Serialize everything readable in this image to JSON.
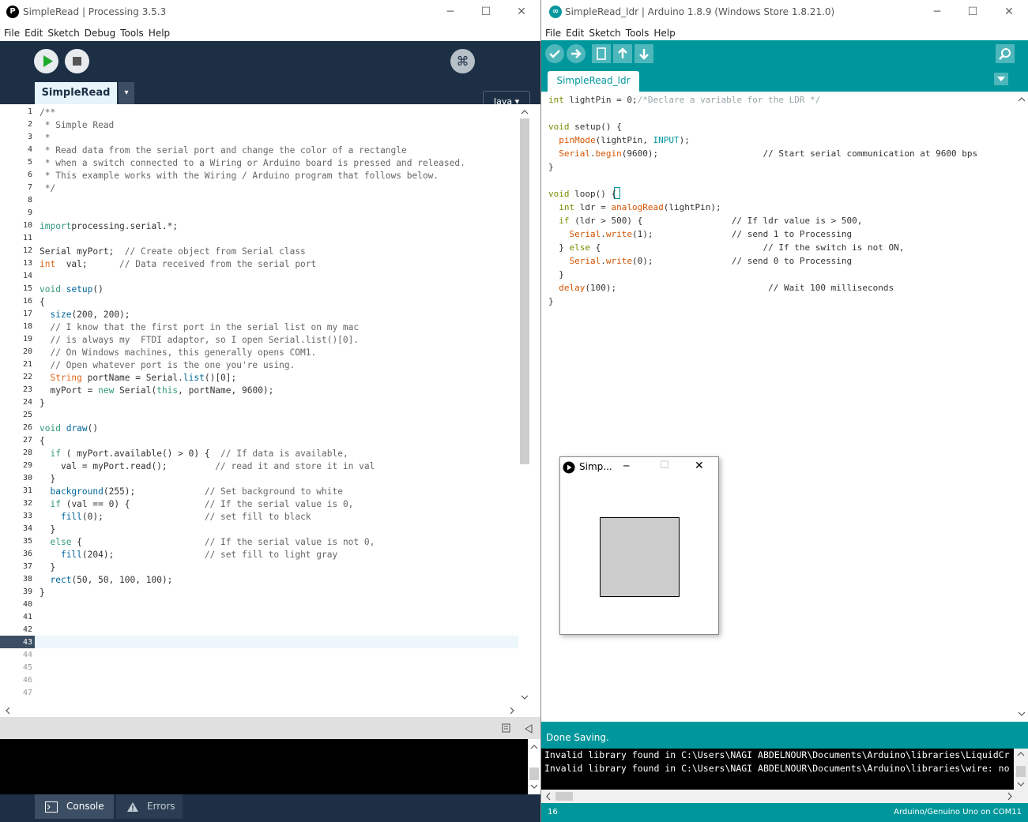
{
  "processing": {
    "title": "SimpleRead | Processing 3.5.3",
    "app_icon": "P",
    "menu": [
      "File",
      "Edit",
      "Sketch",
      "Debug",
      "Tools",
      "Help"
    ],
    "mode": "Java ▾",
    "tab": "SimpleRead",
    "tab_menu": "▾",
    "lines": [
      [
        [
          "cm",
          "/**"
        ]
      ],
      [
        [
          "cm",
          " * Simple Read"
        ]
      ],
      [
        [
          "cm",
          " *"
        ]
      ],
      [
        [
          "cm",
          " * Read data from the serial port and change the color of a rectangle"
        ]
      ],
      [
        [
          "cm",
          " * when a switch connected to a Wiring or Arduino board is pressed and released."
        ]
      ],
      [
        [
          "cm",
          " * This example works with the Wiring / Arduino program that follows below."
        ]
      ],
      [
        [
          "cm",
          " */"
        ]
      ],
      [],
      [],
      [
        [
          "kw",
          "import"
        ],
        [
          "",
          "processing.serial.*;"
        ]
      ],
      [],
      [
        [
          "",
          "Serial myPort;  "
        ],
        [
          "cm",
          "// Create object from Serial class"
        ]
      ],
      [
        [
          "ty",
          "int"
        ],
        [
          "",
          "  val;      "
        ],
        [
          "cm",
          "// Data received from the serial port"
        ]
      ],
      [],
      [
        [
          "kw",
          "void"
        ],
        [
          "",
          " "
        ],
        [
          "fn",
          "setup"
        ],
        [
          "",
          "()"
        ]
      ],
      [
        [
          "",
          "{"
        ]
      ],
      [
        [
          "",
          "  "
        ],
        [
          "fn",
          "size"
        ],
        [
          "",
          "(200, 200);"
        ]
      ],
      [
        [
          "cm",
          "  // I know that the first port in the serial list on my mac"
        ]
      ],
      [
        [
          "cm",
          "  // is always my  FTDI adaptor, so I open Serial.list()[0]."
        ]
      ],
      [
        [
          "cm",
          "  // On Windows machines, this generally opens COM1."
        ]
      ],
      [
        [
          "cm",
          "  // Open whatever port is the one you're using."
        ]
      ],
      [
        [
          "",
          "  "
        ],
        [
          "ty",
          "String"
        ],
        [
          "",
          " portName = Serial."
        ],
        [
          "fn",
          "list"
        ],
        [
          "",
          "()[0];"
        ]
      ],
      [
        [
          "",
          "  myPort = "
        ],
        [
          "kw",
          "new"
        ],
        [
          "",
          " Serial("
        ],
        [
          "kw",
          "this"
        ],
        [
          "",
          ", portName, 9600);"
        ]
      ],
      [
        [
          "",
          "}"
        ]
      ],
      [],
      [
        [
          "kw",
          "void"
        ],
        [
          "",
          " "
        ],
        [
          "fn",
          "draw"
        ],
        [
          "",
          "()"
        ]
      ],
      [
        [
          "",
          "{"
        ]
      ],
      [
        [
          "",
          "  "
        ],
        [
          "kw",
          "if"
        ],
        [
          "",
          " ( myPort.available() > 0) {  "
        ],
        [
          "cm",
          "// If data is available,"
        ]
      ],
      [
        [
          "",
          "    val = myPort.read();         "
        ],
        [
          "cm",
          "// read it and store it in val"
        ]
      ],
      [
        [
          "",
          "  }"
        ]
      ],
      [
        [
          "",
          "  "
        ],
        [
          "fn",
          "background"
        ],
        [
          "",
          "(255);             "
        ],
        [
          "cm",
          "// Set background to white"
        ]
      ],
      [
        [
          "",
          "  "
        ],
        [
          "kw",
          "if"
        ],
        [
          "",
          " (val == 0) {              "
        ],
        [
          "cm",
          "// If the serial value is 0,"
        ]
      ],
      [
        [
          "",
          "    "
        ],
        [
          "fn",
          "fill"
        ],
        [
          "",
          "(0);                   "
        ],
        [
          "cm",
          "// set fill to black"
        ]
      ],
      [
        [
          "",
          "  }"
        ]
      ],
      [
        [
          "",
          "  "
        ],
        [
          "kw",
          "else"
        ],
        [
          "",
          " {                       "
        ],
        [
          "cm",
          "// If the serial value is not 0,"
        ]
      ],
      [
        [
          "",
          "    "
        ],
        [
          "fn",
          "fill"
        ],
        [
          "",
          "(204);                 "
        ],
        [
          "cm",
          "// set fill to light gray"
        ]
      ],
      [
        [
          "",
          "  }"
        ]
      ],
      [
        [
          "",
          "  "
        ],
        [
          "fn",
          "rect"
        ],
        [
          "",
          "(50, 50, 100, 100);"
        ]
      ],
      [
        [
          "",
          "}"
        ]
      ]
    ],
    "line_count": 47,
    "current_line": 43,
    "console_tab": "Console",
    "errors_tab": "Errors"
  },
  "arduino": {
    "title": "SimpleRead_ldr | Arduino 1.8.9 (Windows Store 1.8.21.0)",
    "menu": [
      "File",
      "Edit",
      "Sketch",
      "Tools",
      "Help"
    ],
    "tab": "SimpleRead_ldr",
    "lines": [
      [
        [
          "aty",
          "int"
        ],
        [
          "",
          " lightPin = 0;"
        ],
        [
          "acm",
          "/*Declare a variable for the LDR */"
        ]
      ],
      [],
      [
        [
          "aty",
          "void"
        ],
        [
          "",
          " setup() {"
        ]
      ],
      [
        [
          "",
          "  "
        ],
        [
          "afn",
          "pinMode"
        ],
        [
          "",
          "(lightPin, "
        ],
        [
          "akw",
          "INPUT"
        ],
        [
          "",
          ");"
        ]
      ],
      [
        [
          "",
          "  "
        ],
        [
          "afn",
          "Serial"
        ],
        [
          "",
          "."
        ],
        [
          "afn",
          "begin"
        ],
        [
          "",
          "(9600);                    // Start serial communication at 9600 bps"
        ]
      ],
      [
        [
          "",
          "}"
        ]
      ],
      [],
      [
        [
          "aty",
          "void"
        ],
        [
          "",
          " loop() {"
        ]
      ],
      [
        [
          "",
          "  "
        ],
        [
          "aty",
          "int"
        ],
        [
          "",
          " ldr = "
        ],
        [
          "afn",
          "analogRead"
        ],
        [
          "",
          "(lightPin);"
        ]
      ],
      [
        [
          "",
          "  "
        ],
        [
          "aty",
          "if"
        ],
        [
          "",
          " (ldr > 500) {                 // If ldr value is > 500,"
        ]
      ],
      [
        [
          "",
          "    "
        ],
        [
          "afn",
          "Serial"
        ],
        [
          "",
          "."
        ],
        [
          "afn",
          "write"
        ],
        [
          "",
          "(1);               // send 1 to Processing"
        ]
      ],
      [
        [
          "",
          "  } "
        ],
        [
          "aty",
          "else"
        ],
        [
          "",
          " {                               // If the switch is not ON,"
        ]
      ],
      [
        [
          "",
          "    "
        ],
        [
          "afn",
          "Serial"
        ],
        [
          "",
          "."
        ],
        [
          "afn",
          "write"
        ],
        [
          "",
          "(0);               // send 0 to Processing"
        ]
      ],
      [
        [
          "",
          "  }"
        ]
      ],
      [
        [
          "",
          "  "
        ],
        [
          "afn",
          "delay"
        ],
        [
          "",
          "(100);                             // Wait 100 milliseconds"
        ]
      ],
      [
        [
          "",
          "}"
        ]
      ]
    ],
    "status": "Done Saving.",
    "console_lines": [
      "Invalid library found in C:\\Users\\NAGI ABDELNOUR\\Documents\\Arduino\\libraries\\LiquidCr",
      "Invalid library found in C:\\Users\\NAGI ABDELNOUR\\Documents\\Arduino\\libraries\\wire: no"
    ],
    "line_number": "16",
    "board": "Arduino/Genuino Uno on COM11"
  },
  "sketch_window": {
    "title": "Simp...",
    "fill_gray": "#cccccc"
  }
}
